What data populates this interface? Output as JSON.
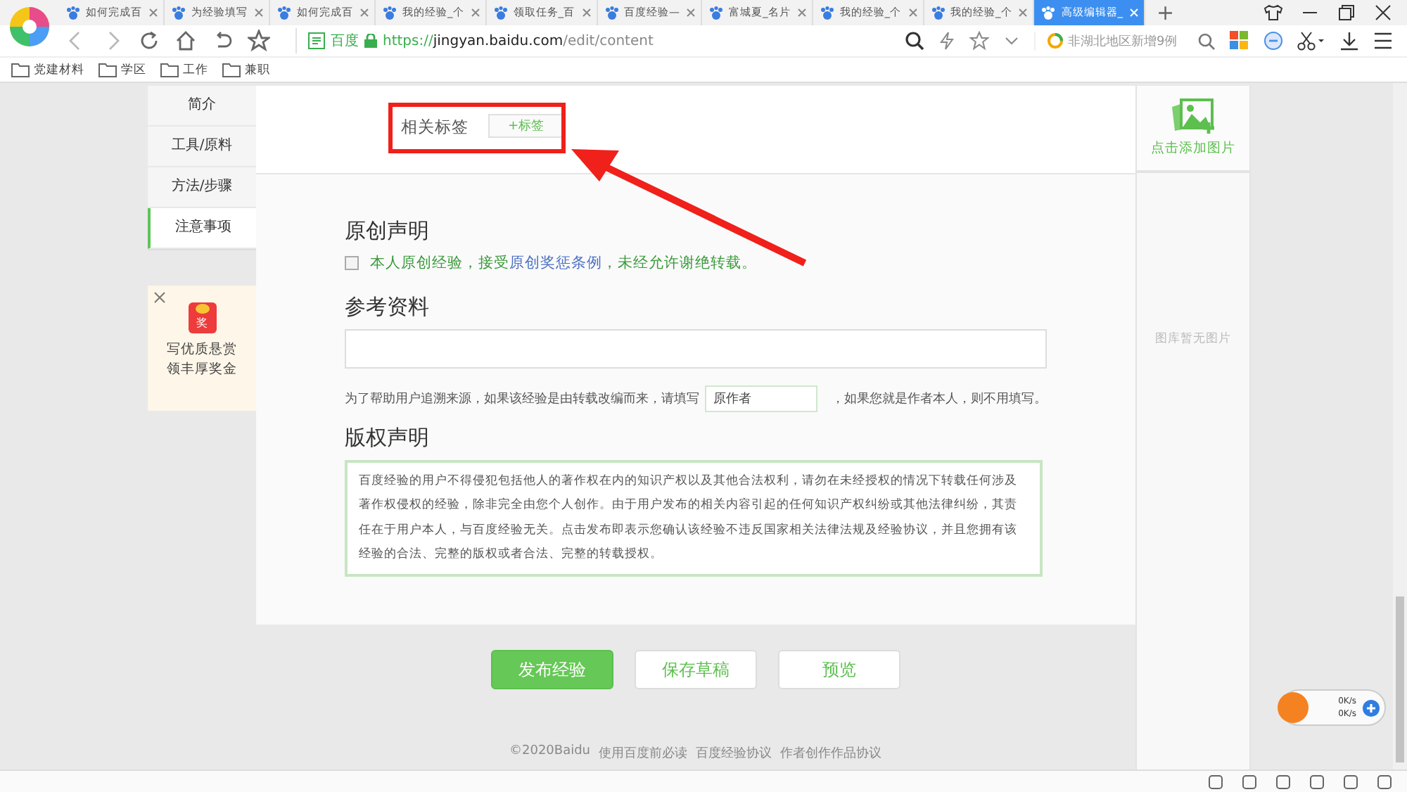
{
  "browser": {
    "tabs": [
      {
        "title": "如何完成百",
        "selected": false
      },
      {
        "title": "为经验填写",
        "selected": false
      },
      {
        "title": "如何完成百",
        "selected": false
      },
      {
        "title": "我的经验_个",
        "selected": false
      },
      {
        "title": "领取任务_百",
        "selected": false
      },
      {
        "title": "百度经验—",
        "selected": false
      },
      {
        "title": "富城夏_名片",
        "selected": false
      },
      {
        "title": "我的经验_个",
        "selected": false
      },
      {
        "title": "我的经验_个",
        "selected": false
      },
      {
        "title": "高级编辑器_",
        "selected": true
      }
    ],
    "new_tab": "+",
    "address": {
      "site_badge": "百度",
      "scheme": "https://",
      "host": "jingyan.baidu.com",
      "path": "/edit/content"
    },
    "search_hint": "非湖北地区新增9例",
    "bookmarks": [
      "党建材料",
      "学区",
      "工作",
      "兼职"
    ],
    "speed": [
      "0K/s",
      "0K/s"
    ]
  },
  "section_nav": [
    {
      "label": "简介",
      "selected": false
    },
    {
      "label": "工具/原料",
      "selected": false
    },
    {
      "label": "方法/步骤",
      "selected": false
    },
    {
      "label": "注意事项",
      "selected": true
    }
  ],
  "promo": {
    "badge": "奖",
    "text": "写优质悬赏领丰厚奖金"
  },
  "tags": {
    "label": "相关标签",
    "button": "+标签"
  },
  "originality": {
    "title": "原创声明",
    "checked": false,
    "before": "本人原创经验，接受",
    "link": "原创奖惩条例",
    "after": "，未经允许谢绝转载。"
  },
  "references": {
    "title": "参考资料",
    "hint_before": "为了帮助用户追溯来源，如果该经验是由转载改编而来，请填写",
    "author_placeholder": "原作者",
    "hint_after": "，如果您就是作者本人，则不用填写。"
  },
  "copyright": {
    "title": "版权声明",
    "text": "百度经验的用户不得侵犯包括他人的著作权在内的知识产权以及其他合法权利，请勿在未经授权的情况下转载任何涉及著作权侵权的经验，除非完全由您个人创作。由于用户发布的相关内容引起的任何知识产权纠纷或其他法律纠纷，其责任在于用户本人，与百度经验无关。点击发布即表示您确认该经验不违反国家相关法律法规及经验协议，并且您拥有该经验的合法、完整的版权或者合法、完整的转载授权。"
  },
  "actions": [
    {
      "label": "发布经验",
      "kind": "primary"
    },
    {
      "label": "保存草稿",
      "kind": "secondary"
    },
    {
      "label": "预览",
      "kind": "secondary"
    }
  ],
  "image_panel": {
    "add_label": "点击添加图片",
    "empty_text": "图库暂无图片"
  },
  "footer": [
    "©2020Baidu",
    "使用百度前必读",
    "百度经验协议",
    "作者创作作品协议"
  ]
}
